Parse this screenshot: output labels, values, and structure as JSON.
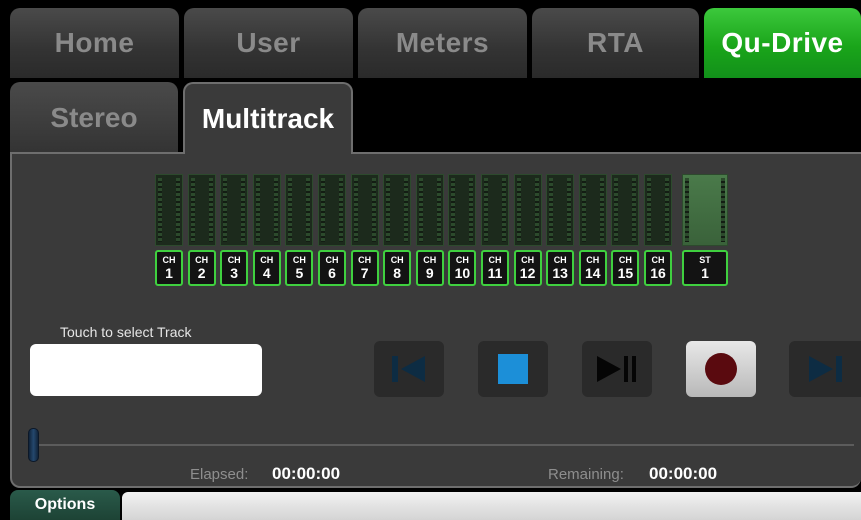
{
  "top_tabs": [
    {
      "label": "Home"
    },
    {
      "label": "User"
    },
    {
      "label": "Meters"
    },
    {
      "label": "RTA"
    },
    {
      "label": "Qu-Drive"
    }
  ],
  "sub_tabs": [
    {
      "label": "Stereo"
    },
    {
      "label": "Multitrack"
    }
  ],
  "channels": [
    {
      "prefix": "CH",
      "number": "1"
    },
    {
      "prefix": "CH",
      "number": "2"
    },
    {
      "prefix": "CH",
      "number": "3"
    },
    {
      "prefix": "CH",
      "number": "4"
    },
    {
      "prefix": "CH",
      "number": "5"
    },
    {
      "prefix": "CH",
      "number": "6"
    },
    {
      "prefix": "CH",
      "number": "7"
    },
    {
      "prefix": "CH",
      "number": "8"
    },
    {
      "prefix": "CH",
      "number": "9"
    },
    {
      "prefix": "CH",
      "number": "10"
    },
    {
      "prefix": "CH",
      "number": "11"
    },
    {
      "prefix": "CH",
      "number": "12"
    },
    {
      "prefix": "CH",
      "number": "13"
    },
    {
      "prefix": "CH",
      "number": "14"
    },
    {
      "prefix": "CH",
      "number": "15"
    },
    {
      "prefix": "CH",
      "number": "16"
    }
  ],
  "stereo_channel": {
    "prefix": "ST",
    "number": "1"
  },
  "track_select": {
    "caption": "Touch to select Track",
    "value": ""
  },
  "transport": {
    "skip_back_icon": "skip-to-start-icon",
    "stop_icon": "stop-icon",
    "play_pause_icon": "play-pause-icon",
    "record_icon": "record-icon",
    "skip_forward_icon": "skip-to-end-icon"
  },
  "time": {
    "elapsed_label": "Elapsed:",
    "elapsed_value": "00:00:00",
    "remaining_label": "Remaining:",
    "remaining_value": "00:00:00"
  },
  "timeline": {
    "position": 0
  },
  "footer": {
    "options_label": "Options"
  },
  "colors": {
    "accent_green": "#1aa51a",
    "stop_blue": "#1c8fd8",
    "record_red": "#5a0a0f"
  }
}
